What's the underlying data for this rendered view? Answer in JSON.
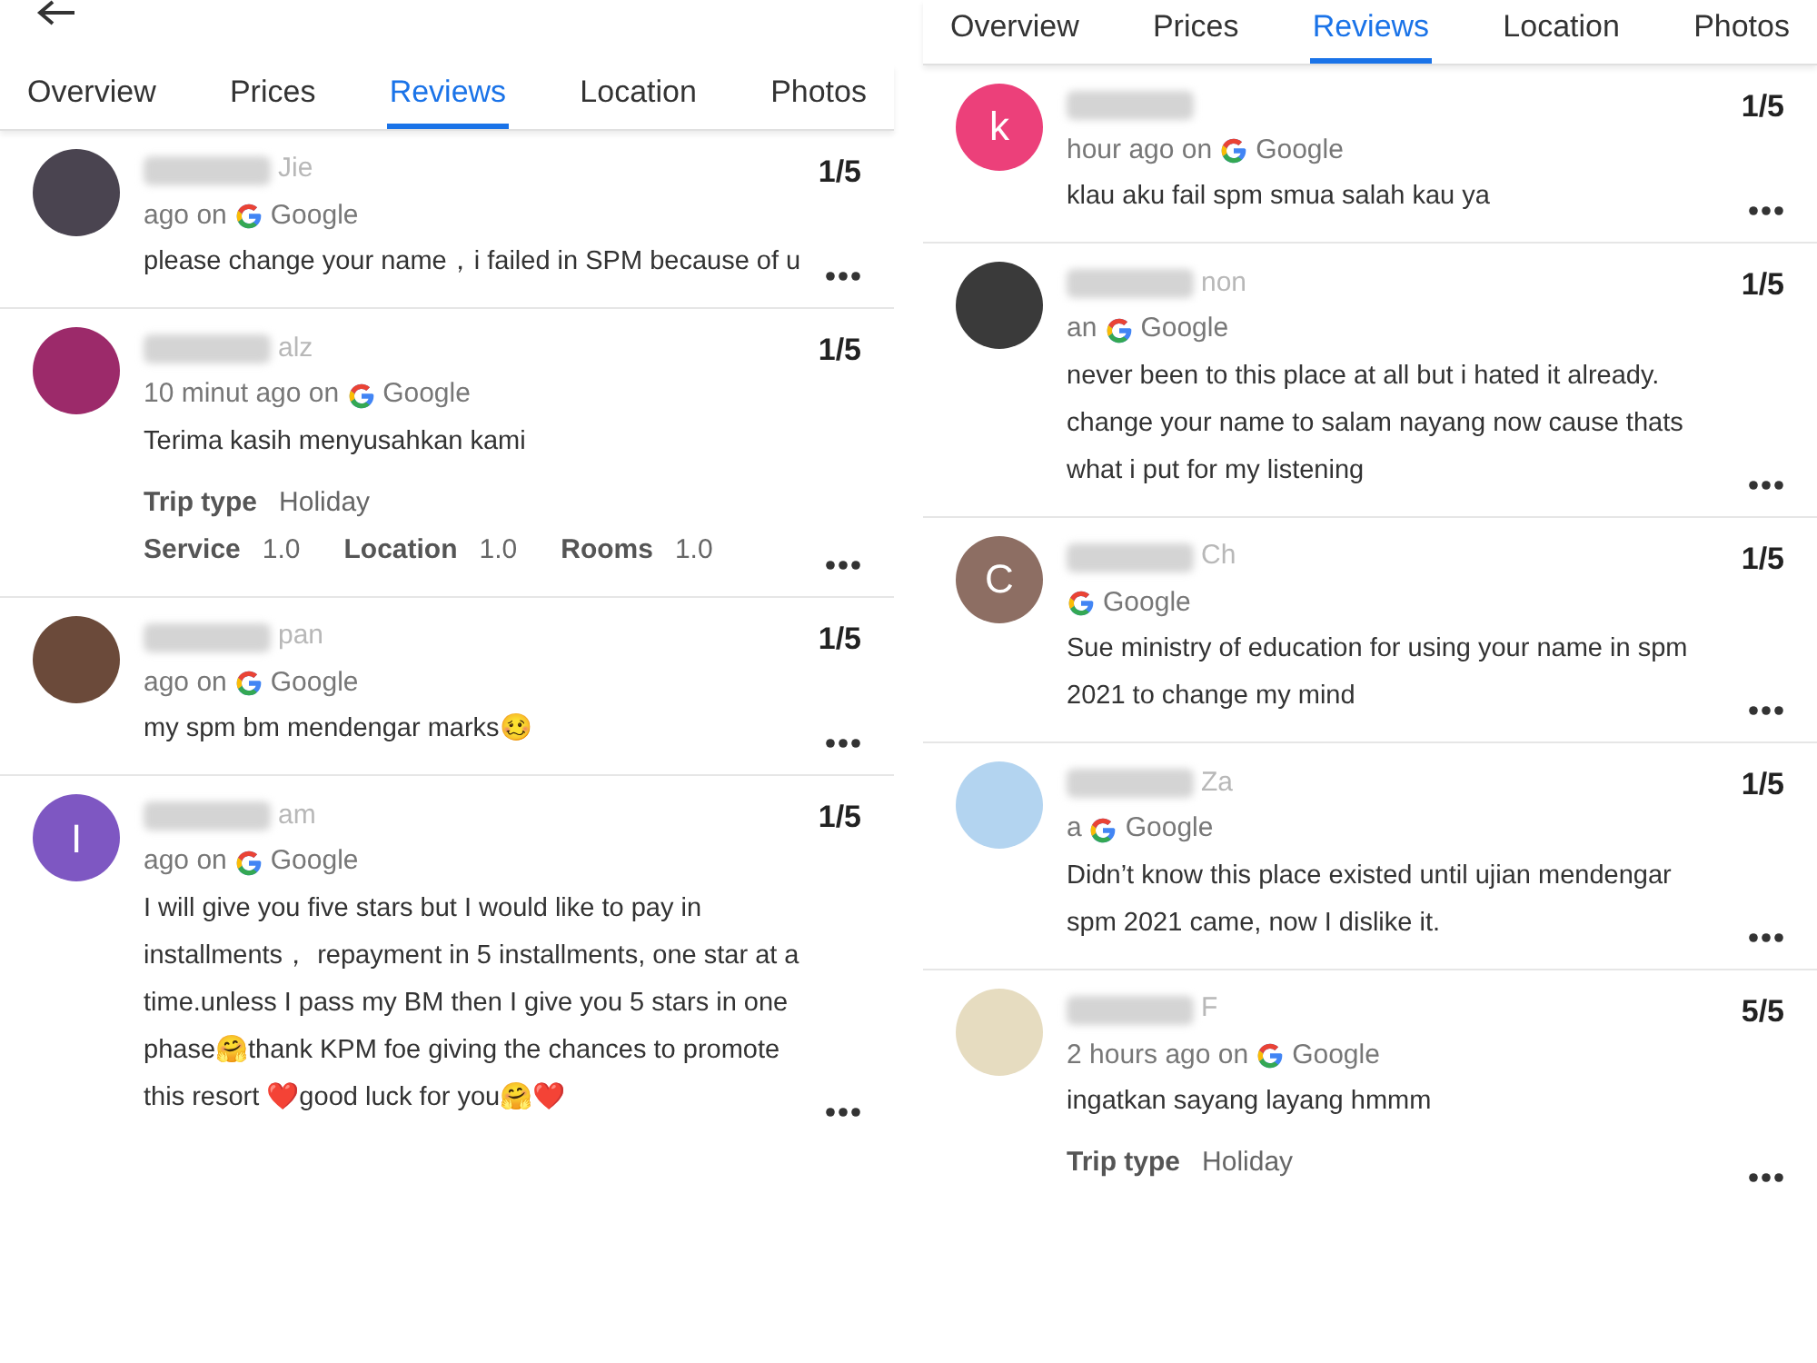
{
  "panels": [
    {
      "header": {
        "back": true
      },
      "tabs": [
        {
          "label": "Overview",
          "selected": false
        },
        {
          "label": "Prices",
          "selected": false
        },
        {
          "label": "Reviews",
          "selected": true
        },
        {
          "label": "Location",
          "selected": false
        },
        {
          "label": "Photos",
          "selected": false
        }
      ],
      "reviews": [
        {
          "avatar": {
            "kind": "photo",
            "color": "#4a4450"
          },
          "name": "Jie",
          "time": "ago on",
          "source": "Google",
          "score": "1/5",
          "text": "please change your name，i failed in SPM because of u"
        },
        {
          "avatar": {
            "kind": "photo",
            "color": "#9c2a6a"
          },
          "name": "alz",
          "time": "10 minut ago on",
          "source": "Google",
          "score": "1/5",
          "text": "Terima kasih menyusahkan kami",
          "trip": {
            "label": "Trip type",
            "value": "Holiday"
          },
          "ratings": [
            {
              "label": "Service",
              "value": "1.0"
            },
            {
              "label": "Location",
              "value": "1.0"
            },
            {
              "label": "Rooms",
              "value": "1.0"
            }
          ]
        },
        {
          "avatar": {
            "kind": "photo",
            "color": "#6b4a3a"
          },
          "name": "pan",
          "time": "ago on",
          "source": "Google",
          "score": "1/5",
          "text": "my spm bm mendengar marks🥴"
        },
        {
          "avatar": {
            "kind": "letter",
            "letter": "I",
            "color": "#7e57c2"
          },
          "name": "am",
          "time": "ago on",
          "source": "Google",
          "score": "1/5",
          "text": "I will give you five stars but I would like to pay in installments， repayment in 5 installments, one star at a time.unless I pass my BM then I give you 5 stars in one phase🤗thank KPM foe giving the chances to promote this resort ❤️good luck for you🤗❤️"
        }
      ]
    },
    {
      "tabs": [
        {
          "label": "Overview",
          "selected": false
        },
        {
          "label": "Prices",
          "selected": false
        },
        {
          "label": "Reviews",
          "selected": true
        },
        {
          "label": "Location",
          "selected": false
        },
        {
          "label": "Photos",
          "selected": false
        }
      ],
      "reviews": [
        {
          "avatar": {
            "kind": "letter",
            "letter": "k",
            "color": "#ec407a"
          },
          "time": "hour ago on",
          "source": "Google",
          "score": "1/5",
          "text": "klau aku fail spm smua salah kau ya"
        },
        {
          "avatar": {
            "kind": "photo",
            "color": "#3a3a3a"
          },
          "name": "non",
          "time": "an",
          "source": "Google",
          "score": "1/5",
          "text": "never been to this place at all but i hated it already. change your name to salam nayang now cause thats what i put for my listening"
        },
        {
          "avatar": {
            "kind": "letter",
            "letter": "C",
            "color": "#8d6e63"
          },
          "name": "Ch",
          "source": "Google",
          "score": "1/5",
          "text": "Sue ministry of education for using your name in spm 2021 to change my mind"
        },
        {
          "avatar": {
            "kind": "photo",
            "color": "#b3d4f0"
          },
          "name": "Za",
          "time": "a",
          "source": "Google",
          "score": "1/5",
          "text": "Didn’t know this place existed until ujian mendengar spm 2021 came, now I dislike it."
        },
        {
          "avatar": {
            "kind": "photo",
            "color": "#e6dcc0"
          },
          "name": "F",
          "time": "2 hours ago on",
          "source": "Google",
          "score": "5/5",
          "text": "ingatkan sayang layang hmmm",
          "trip": {
            "label": "Trip type",
            "value": "Holiday"
          }
        }
      ]
    }
  ]
}
